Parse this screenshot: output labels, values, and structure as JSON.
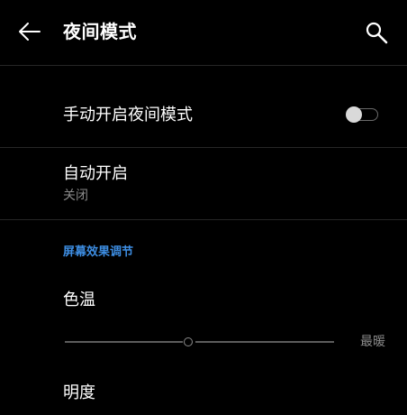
{
  "appbar": {
    "title": "夜间模式",
    "back_icon": "arrow-left-icon",
    "search_icon": "search-icon"
  },
  "settings": {
    "manual_toggle": {
      "label": "手动开启夜间模式",
      "enabled": false
    },
    "auto_enable": {
      "label": "自动开启",
      "value": "关闭"
    },
    "section_header": "屏幕效果调节",
    "color_temperature": {
      "label": "色温",
      "end_label": "最暖",
      "level_fraction": 0.45
    },
    "brightness": {
      "label": "明度"
    }
  },
  "colors": {
    "background": "#000000",
    "accent": "#3d8de2",
    "secondary_text": "#8a8a8a",
    "divider": "#262626"
  }
}
